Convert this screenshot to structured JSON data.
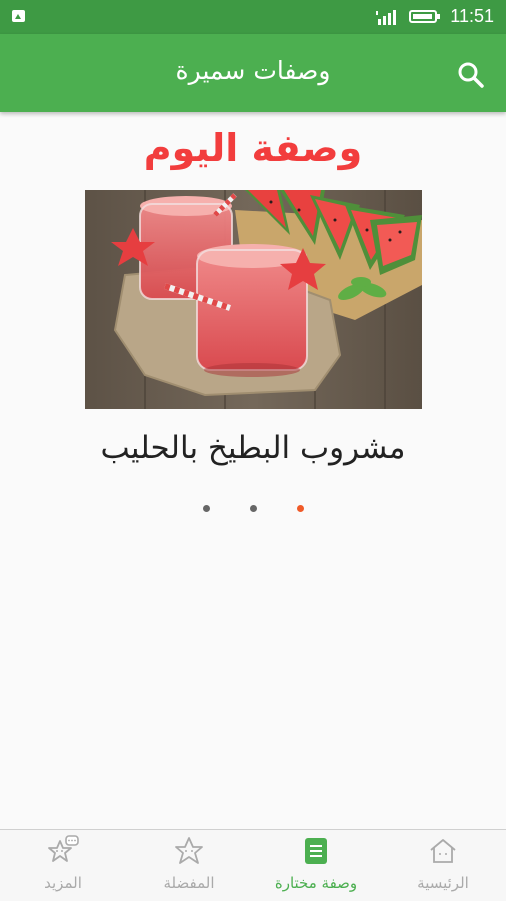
{
  "status_bar": {
    "time": "11:51",
    "icons": [
      "image-notification-icon",
      "signal-icon",
      "battery-icon"
    ]
  },
  "app_bar": {
    "title": "وصفات سميرة",
    "search_icon": "search-icon"
  },
  "featured": {
    "heading": "وصفة اليوم",
    "recipe_name": "مشروب البطيخ بالحليب",
    "image": "watermelon-drink-photo",
    "pager": {
      "count": 3,
      "active_index": 2
    }
  },
  "bottom_nav": {
    "items": [
      {
        "label": "المزيد",
        "icon": "more-chat-icon",
        "active": false
      },
      {
        "label": "المفضلة",
        "icon": "star-icon",
        "active": false
      },
      {
        "label": "وصفة مختارة",
        "icon": "list-icon",
        "active": true
      },
      {
        "label": "الرئيسية",
        "icon": "home-icon",
        "active": false
      }
    ]
  },
  "colors": {
    "status_bar": "#3e9a44",
    "app_bar": "#4caf50",
    "heading": "#f23d3d",
    "pager_active": "#f05a28",
    "pager_inactive": "#666666",
    "nav_active": "#4caf50",
    "nav_inactive": "#aaaaaa"
  }
}
